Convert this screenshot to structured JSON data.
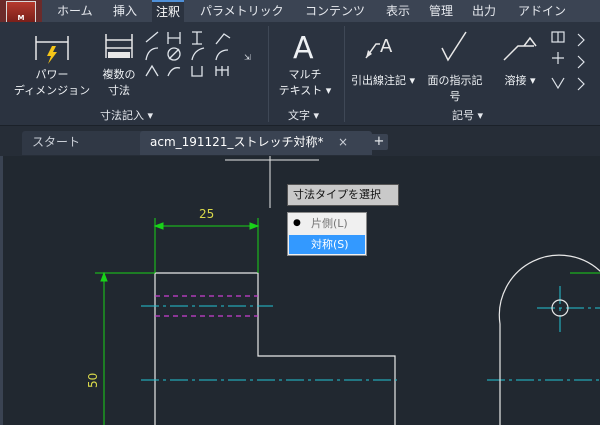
{
  "app_logo": {
    "letter": "M"
  },
  "menu": {
    "tabs": [
      "ホーム",
      "挿入",
      "注釈",
      "パラメトリック",
      "コンテンツ",
      "表示",
      "管理",
      "出力",
      "アドイン"
    ],
    "active": "注釈"
  },
  "ribbon": {
    "dimension_panel": {
      "power_dim_label_1": "パワー",
      "power_dim_label_2": "ディメンジョン",
      "multi_dim_label_1": "複数の",
      "multi_dim_label_2": "寸法",
      "title": "寸法記入 ▾"
    },
    "text_panel": {
      "mtext_label_1": "マルチ",
      "mtext_label_2": "テキスト ▾",
      "title": "文字 ▾"
    },
    "symbol_panel": {
      "leader_label": "引出線注記 ▾",
      "surface_label_1": "面の指示記",
      "surface_label_2": "号",
      "weld_label": "溶接 ▾",
      "title": "記号 ▾"
    }
  },
  "doc_tabs": {
    "start": "スタート",
    "active": "acm_191121_ストレッチ対称*",
    "close": "×",
    "new": "+"
  },
  "prompt": {
    "title": "寸法タイプを選択",
    "options": [
      "片側(L)",
      "対称(S)"
    ],
    "selected_index": 1
  },
  "drawing": {
    "dim_horizontal": "25",
    "dim_vertical": "50"
  },
  "colors": {
    "geometry": "#e8e8e8",
    "dimension": "#19d219",
    "dim_text": "#d8d84a",
    "centerline": "#22c3d4",
    "hidden": "#c93fd0",
    "selection": "#3399ff"
  }
}
